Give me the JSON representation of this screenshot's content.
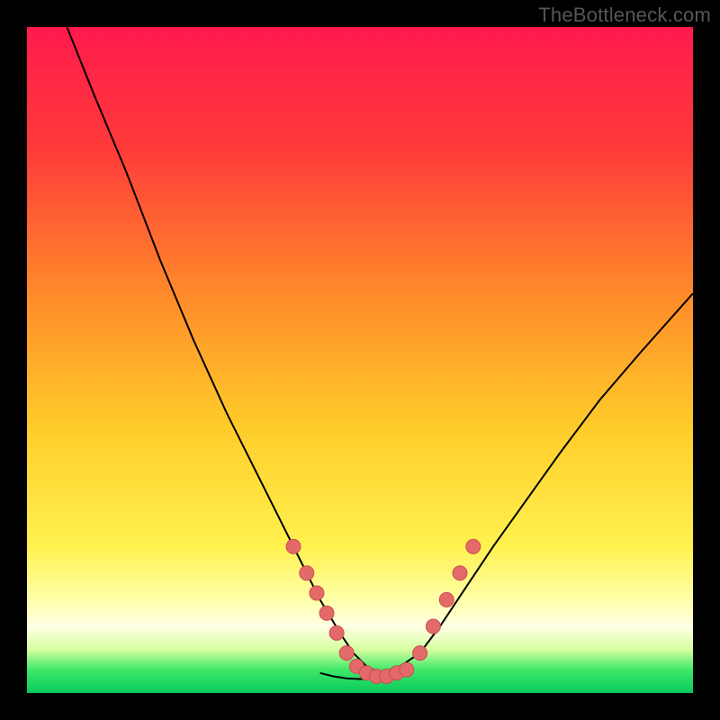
{
  "watermark": "TheBottleneck.com",
  "colors": {
    "frame": "#000000",
    "gradient_stops": [
      {
        "offset": 0.0,
        "color": "#ff1a4d"
      },
      {
        "offset": 0.18,
        "color": "#ff3a3a"
      },
      {
        "offset": 0.4,
        "color": "#ff8a2a"
      },
      {
        "offset": 0.6,
        "color": "#ffcc2a"
      },
      {
        "offset": 0.78,
        "color": "#fff24f"
      },
      {
        "offset": 0.86,
        "color": "#ffffa8"
      },
      {
        "offset": 0.9,
        "color": "#ffffe5"
      },
      {
        "offset": 0.935,
        "color": "#d6ff9e"
      },
      {
        "offset": 0.965,
        "color": "#3fe86a"
      },
      {
        "offset": 1.0,
        "color": "#08c95c"
      }
    ],
    "curve": "#000000",
    "marker_fill": "#e46a6a",
    "marker_stroke": "#c94f4f"
  },
  "chart_data": {
    "type": "line",
    "title": "",
    "xlabel": "",
    "ylabel": "",
    "xlim": [
      0,
      100
    ],
    "ylim": [
      0,
      100
    ],
    "grid": false,
    "legend": false,
    "series": [
      {
        "name": "bottleneck-curve-left",
        "x": [
          6,
          10,
          15,
          20,
          25,
          30,
          35,
          40,
          44,
          47,
          49,
          51,
          53
        ],
        "y": [
          100,
          90,
          78,
          65,
          53,
          42,
          32,
          22,
          14,
          9,
          6,
          4,
          3
        ]
      },
      {
        "name": "bottleneck-curve-right",
        "x": [
          53,
          56,
          59,
          62,
          66,
          70,
          75,
          80,
          86,
          92,
          100
        ],
        "y": [
          3,
          4,
          6,
          10,
          16,
          22,
          29,
          36,
          44,
          51,
          60
        ]
      },
      {
        "name": "bottleneck-floor",
        "x": [
          44,
          46,
          48,
          50,
          52,
          54,
          56,
          58
        ],
        "y": [
          3,
          2.5,
          2.2,
          2.1,
          2.1,
          2.3,
          2.6,
          3.2
        ]
      }
    ],
    "markers": {
      "name": "highlighted-points",
      "points": [
        {
          "x": 40,
          "y": 22
        },
        {
          "x": 42,
          "y": 18
        },
        {
          "x": 43.5,
          "y": 15
        },
        {
          "x": 45,
          "y": 12
        },
        {
          "x": 46.5,
          "y": 9
        },
        {
          "x": 48,
          "y": 6
        },
        {
          "x": 49.5,
          "y": 4
        },
        {
          "x": 51,
          "y": 3
        },
        {
          "x": 52.5,
          "y": 2.5
        },
        {
          "x": 54,
          "y": 2.5
        },
        {
          "x": 55.5,
          "y": 3
        },
        {
          "x": 57,
          "y": 3.5
        },
        {
          "x": 59,
          "y": 6
        },
        {
          "x": 61,
          "y": 10
        },
        {
          "x": 63,
          "y": 14
        },
        {
          "x": 65,
          "y": 18
        },
        {
          "x": 67,
          "y": 22
        }
      ]
    }
  }
}
